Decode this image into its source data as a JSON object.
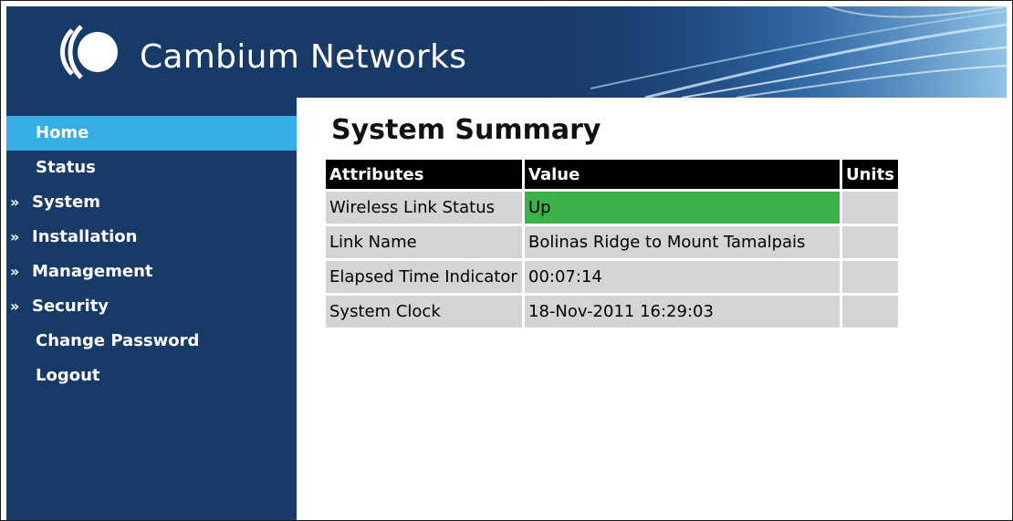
{
  "header": {
    "brand": "Cambium Networks",
    "logo_icon": "cambium-logo-icon",
    "background_color": "#183a68"
  },
  "sidebar": {
    "active_color": "#35aee4",
    "items": [
      {
        "label": "Home",
        "expandable": false,
        "active": true
      },
      {
        "label": "Status",
        "expandable": false,
        "active": false
      },
      {
        "label": "System",
        "expandable": true,
        "active": false
      },
      {
        "label": "Installation",
        "expandable": true,
        "active": false
      },
      {
        "label": "Management",
        "expandable": true,
        "active": false
      },
      {
        "label": "Security",
        "expandable": true,
        "active": false
      },
      {
        "label": "Change Password",
        "expandable": false,
        "active": false
      },
      {
        "label": "Logout",
        "expandable": false,
        "active": false
      }
    ],
    "expand_marker": "»"
  },
  "main": {
    "title": "System Summary",
    "table": {
      "headers": [
        "Attributes",
        "Value",
        "Units"
      ],
      "rows": [
        {
          "attribute": "Wireless Link Status",
          "value": "Up",
          "units": "",
          "status_color": "#3cb04a"
        },
        {
          "attribute": "Link Name",
          "value": "Bolinas Ridge to Mount Tamalpais",
          "units": ""
        },
        {
          "attribute": "Elapsed Time Indicator",
          "value": "00:07:14",
          "units": ""
        },
        {
          "attribute": "System Clock",
          "value": "18-Nov-2011 16:29:03",
          "units": ""
        }
      ]
    }
  }
}
